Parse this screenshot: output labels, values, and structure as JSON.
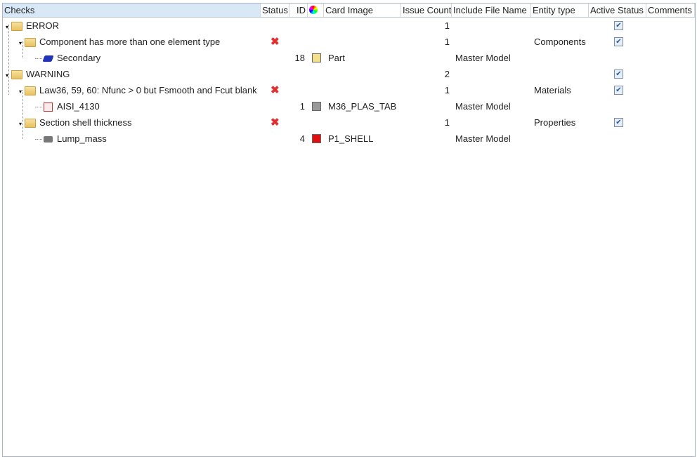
{
  "columns": {
    "checks": "Checks",
    "status": "Status",
    "id": "ID",
    "color_icon": "color-wheel-icon",
    "card_image": "Card Image",
    "issue_count": "Issue Count",
    "include_file": "Include File Name",
    "entity_type": "Entity type",
    "active_status": "Active Status",
    "comments": "Comments"
  },
  "rows": [
    {
      "label": "ERROR",
      "level": 0,
      "issue_count": "1",
      "active": true
    },
    {
      "label": "Component has more than one element type",
      "level": 1,
      "status": "error",
      "issue_count": "1",
      "entity_type": "Components",
      "active": true
    },
    {
      "label": "Secondary",
      "level": 2,
      "icon": "component-icon",
      "id": "18",
      "color": "#f5e08a",
      "card_image": "Part",
      "include_file": "Master Model"
    },
    {
      "label": "WARNING",
      "level": 0,
      "issue_count": "2",
      "active": true
    },
    {
      "label": "Law36, 59, 60: Nfunc > 0 but Fsmooth and Fcut blank",
      "level": 1,
      "status": "error",
      "issue_count": "1",
      "entity_type": "Materials",
      "active": true
    },
    {
      "label": "AISI_4130",
      "level": 2,
      "icon": "material-icon",
      "id": "1",
      "color": "#999999",
      "card_image": "M36_PLAS_TAB",
      "include_file": "Master Model"
    },
    {
      "label": "Section shell thickness",
      "level": 1,
      "status": "error",
      "issue_count": "1",
      "entity_type": "Properties",
      "active": true
    },
    {
      "label": "Lump_mass",
      "level": 2,
      "icon": "property-icon",
      "id": "4",
      "color": "#e01010",
      "card_image": "P1_SHELL",
      "include_file": "Master Model"
    }
  ]
}
